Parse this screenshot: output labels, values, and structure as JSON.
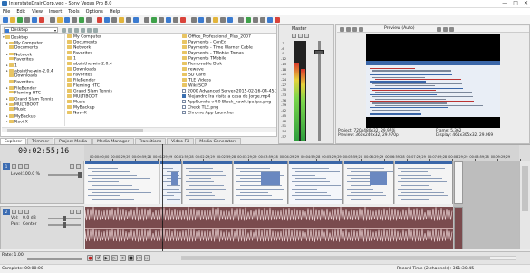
{
  "window": {
    "title": "InterstateDrainCorp.veg - Sony Vegas Pro 8.0",
    "controls": [
      "—",
      "□",
      "✕"
    ]
  },
  "menu": [
    "File",
    "Edit",
    "View",
    "Insert",
    "Tools",
    "Options",
    "Help"
  ],
  "toolbar": {
    "button_colors": [
      "#3b7bd0",
      "#e2b43a",
      "#3fa24a",
      "#7d7d7d",
      "#3b7bd0",
      "#d9433a",
      "#7d7d7d",
      "#e2b43a",
      "#3b7bd0",
      "#7d7d7d",
      "#3fa24a",
      "#7d7d7d",
      "#d9433a",
      "#3b7bd0",
      "#7d7d7d",
      "#e2b43a",
      "#7d7d7d",
      "#3b7bd0",
      "#7d7d7d",
      "#3fa24a",
      "#7d7d7d",
      "#3b7bd0",
      "#7d7d7d",
      "#d9433a",
      "#7d7d7d",
      "#3b7bd0",
      "#7d7d7d",
      "#e2b43a",
      "#7d7d7d",
      "#3b7bd0",
      "#7d7d7d",
      "#3fa24a",
      "#7d7d7d",
      "#7d7d7d",
      "#3b7bd0",
      "#d9433a"
    ]
  },
  "explorer": {
    "location": "Desktop",
    "tree": [
      {
        "label": "Desktop",
        "indent": 0,
        "expand": "▾"
      },
      {
        "label": "My Computer",
        "indent": 1,
        "expand": "▸"
      },
      {
        "label": "Documents",
        "indent": 1,
        "expand": ""
      },
      {
        "label": "Network",
        "indent": 1,
        "expand": "▸"
      },
      {
        "label": "Favorites",
        "indent": 1,
        "expand": ""
      },
      {
        "label": "1",
        "indent": 1,
        "expand": "▸"
      },
      {
        "label": "absinthe-win-2.0.4",
        "indent": 1,
        "expand": "▸"
      },
      {
        "label": "Downloads",
        "indent": 1,
        "expand": ""
      },
      {
        "label": "Favorites",
        "indent": 1,
        "expand": ""
      },
      {
        "label": "FileBender",
        "indent": 1,
        "expand": "▸"
      },
      {
        "label": "Fleming HTC",
        "indent": 1,
        "expand": ""
      },
      {
        "label": "Grand Slam Tennis",
        "indent": 1,
        "expand": "▸"
      },
      {
        "label": "MULTIBOOT",
        "indent": 1,
        "expand": "▸"
      },
      {
        "label": "Music",
        "indent": 1,
        "expand": ""
      },
      {
        "label": "MyBackup",
        "indent": 1,
        "expand": "▸"
      },
      {
        "label": "Navi-X",
        "indent": 1,
        "expand": "▸"
      }
    ],
    "files_col1": [
      {
        "label": "My Computer",
        "kind": "folder"
      },
      {
        "label": "Documents",
        "kind": "folder"
      },
      {
        "label": "Network",
        "kind": "folder"
      },
      {
        "label": "Favorites",
        "kind": "folder"
      },
      {
        "label": "1",
        "kind": "folder"
      },
      {
        "label": "absinthe-win-2.0.4",
        "kind": "folder"
      },
      {
        "label": "Downloads",
        "kind": "folder"
      },
      {
        "label": "Favorites",
        "kind": "folder"
      },
      {
        "label": "FileBender",
        "kind": "folder"
      },
      {
        "label": "Fleming HTC",
        "kind": "folder"
      },
      {
        "label": "Grand Slam Tennis",
        "kind": "folder"
      },
      {
        "label": "MULTIBOOT",
        "kind": "folder"
      },
      {
        "label": "Music",
        "kind": "folder"
      },
      {
        "label": "MyBackup",
        "kind": "folder"
      },
      {
        "label": "Navi-X",
        "kind": "folder"
      }
    ],
    "files_col2": [
      {
        "label": "Office_Professional_Plus_2007",
        "kind": "folder"
      },
      {
        "label": "Payments - ConEd",
        "kind": "folder"
      },
      {
        "label": "Payments - Time Warner Cable",
        "kind": "folder"
      },
      {
        "label": "Payments - TMobile Tomas",
        "kind": "folder"
      },
      {
        "label": "Payments TMobile",
        "kind": "folder"
      },
      {
        "label": "Removable Disk",
        "kind": "folder"
      },
      {
        "label": "rewave",
        "kind": "folder"
      },
      {
        "label": "SD Card",
        "kind": "folder"
      },
      {
        "label": "TLE Videos",
        "kind": "folder"
      },
      {
        "label": "Wiki SCP",
        "kind": "folder"
      },
      {
        "label": "2000 Advanced Server-2015-02-16-04-45-38.",
        "kind": "doc"
      },
      {
        "label": "Alejandro Ira visita a casa de Jorge.mp4",
        "kind": "video"
      },
      {
        "label": "AppBundle-v4.0-Black_hawk.ipa.ipa.png",
        "kind": "doc"
      },
      {
        "label": "Check TLE.png",
        "kind": "doc"
      },
      {
        "label": "Chrome App Launcher",
        "kind": "doc"
      }
    ]
  },
  "window_tabs": [
    "Explorer",
    "Trimmer",
    "Project Media",
    "Media Manager",
    "Transitions",
    "Video FX",
    "Media Generators"
  ],
  "master": {
    "title": "Master",
    "db_labels": [
      "-3",
      "-6",
      "-9",
      "-12",
      "-15",
      "-18",
      "-21",
      "-24",
      "-27",
      "-30",
      "-33",
      "-36",
      "-39",
      "-42",
      "-45",
      "-48",
      "-51",
      "-54",
      "-57"
    ],
    "levels": [
      0.78,
      0.72
    ]
  },
  "preview": {
    "mode": "Preview (Auto)",
    "project_line": "Project:  720x480x32, 29.970i",
    "preview_line": "Preview:  360x240x32, 29.970p",
    "frame_line": "Frame:      5,362",
    "display_line": "Display:   461x305x32, 29.069"
  },
  "timeline": {
    "timecode": "00:02:55;16",
    "ruler_labels": [
      "00:00:00;00",
      "00:00:29;29",
      "00:00:59;28",
      "00:01:29;29",
      "00:01:59;28",
      "00:02:29;29",
      "00:02:59;28",
      "00:03:29;29",
      "00:03:59;28",
      "00:04:29;29",
      "00:04:59;28",
      "00:05:29;29",
      "00:05:59;28",
      "00:06:29;29",
      "00:06:59;28",
      "00:07:29;29",
      "00:07:59;28",
      "00:08:29;29",
      "00:08:59;28",
      "00:09:29;29"
    ],
    "video_track": {
      "number": "1",
      "level_label": "Level:",
      "level_value": "100.0 %"
    },
    "audio_track": {
      "number": "2",
      "vol_label": "Vol:",
      "vol_value": "0.0 dB",
      "pan_label": "Pan:",
      "pan_value": "Center"
    }
  },
  "transport": {
    "rate_label": "Rate: 1.00",
    "buttons": [
      "●",
      "↺",
      "▶",
      "▷",
      "⏸",
      "■",
      "⏮",
      "⏭"
    ]
  },
  "status": {
    "left": "Complete: 00:00:00",
    "right": "Record Time (2 channels): 361:30:45"
  }
}
